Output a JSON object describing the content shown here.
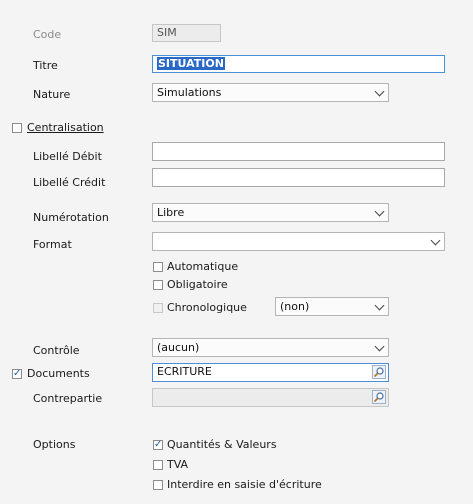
{
  "form": {
    "code": {
      "label": "Code",
      "value": "SIM"
    },
    "titre": {
      "label": "Titre",
      "value": "SITUATION"
    },
    "nature": {
      "label": "Nature",
      "value": "Simulations"
    },
    "centralisation": {
      "label": "Centralisation",
      "checked": false
    },
    "libelle_debit": {
      "label": "Libellé Débit",
      "value": ""
    },
    "libelle_credit": {
      "label": "Libellé Crédit",
      "value": ""
    },
    "numerotation": {
      "label": "Numérotation",
      "value": "Libre"
    },
    "format": {
      "label": "Format",
      "value": ""
    },
    "automatique": {
      "label": "Automatique",
      "checked": false
    },
    "obligatoire": {
      "label": "Obligatoire",
      "checked": false
    },
    "chronologique": {
      "label": "Chronologique",
      "checked": false,
      "value": "(non)"
    },
    "controle": {
      "label": "Contrôle",
      "value": "(aucun)"
    },
    "documents": {
      "label": "Documents",
      "checked": true,
      "value": "ECRITURE"
    },
    "contrepartie": {
      "label": "Contrepartie",
      "value": ""
    },
    "options": {
      "label": "Options",
      "quantites": {
        "label": "Quantités & Valeurs",
        "checked": true
      },
      "tva": {
        "label": "TVA",
        "checked": false
      },
      "interdire": {
        "label": "Interdire en saisie d'écriture",
        "checked": false
      }
    }
  },
  "icons": {
    "lookup": "magnifier-lookup-icon",
    "dropdown": "chevron-down-icon",
    "check": "check-icon"
  },
  "colors": {
    "accent": "#2a68c8",
    "check": "#1f5ea8"
  }
}
